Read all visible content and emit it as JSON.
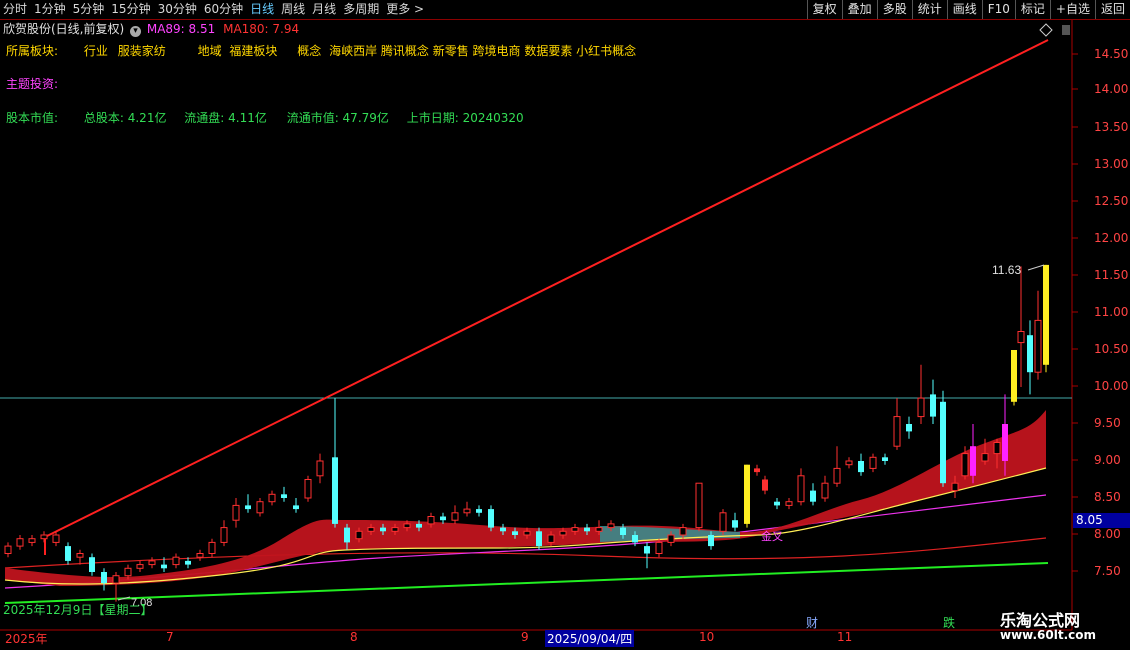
{
  "toolbar": {
    "periods": [
      "分时",
      "1分钟",
      "5分钟",
      "15分钟",
      "30分钟",
      "60分钟",
      "日线",
      "周线",
      "月线",
      "多周期",
      "更多 >"
    ],
    "active_period": "日线",
    "right_tools": [
      "复权",
      "叠加",
      "多股",
      "统计",
      "画线",
      "F10",
      "标记",
      "+自选",
      "返回"
    ]
  },
  "header": {
    "stock_title": "欣贺股份(日线,前复权)",
    "ma89_label": "MA89: 8.51",
    "ma180_label": "MA180: 7.94"
  },
  "info": {
    "sector_label": "所属板块:",
    "industry_key": "行业",
    "industry_value": "服装家纺",
    "region_key": "地域",
    "region_value": "福建板块",
    "concept_key": "概念",
    "concept_value": "海峡西岸 腾讯概念 新零售 跨境电商 数据要素 小红书概念",
    "theme_label": "主题投资:",
    "equity_label": "股本市值:",
    "total_shares": "总股本: 4.21亿",
    "float_shares": "流通盘:  4.11亿",
    "float_cap": "流通市值:  47.79亿",
    "listing_date": "上市日期: 20240320"
  },
  "chart_data": {
    "type": "candlestick",
    "y_ticks": [
      "14.50",
      "14.00",
      "13.50",
      "13.00",
      "12.50",
      "12.00",
      "11.50",
      "11.00",
      "10.50",
      "10.00",
      "9.50",
      "9.00",
      "8.50",
      "8.00",
      "7.50"
    ],
    "high_annotation": "11.63",
    "low_annotation": "7.08",
    "current_price": "8.05",
    "cursor_date": "2025年12月9日【星期二】",
    "x_labels": [
      "2025年",
      "7",
      "8",
      "9",
      "2025/09/04/四",
      "10",
      "11"
    ],
    "event_markers": [
      "财",
      "跌"
    ],
    "signal_label": "金叉",
    "ylim": [
      7.2,
      14.7
    ]
  },
  "watermark": {
    "line1": "乐淘公式网",
    "line2": "www.60lt.com"
  }
}
